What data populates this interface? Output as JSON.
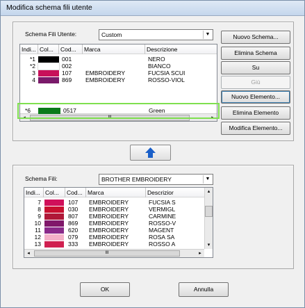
{
  "window": {
    "title": "Modifica schema fili utente"
  },
  "top": {
    "label": "Schema Fili Utente:",
    "combo_value": "Custom",
    "columns": [
      "Indi...",
      "Col...",
      "Cod...",
      "Marca",
      "Descrizione"
    ],
    "rows": [
      {
        "idx": "*1",
        "color": "#000000",
        "code": "001",
        "brand": "",
        "desc": "NERO"
      },
      {
        "idx": "*2",
        "color": "#ffffff",
        "code": "002",
        "brand": "",
        "desc": "BIANCO"
      },
      {
        "idx": "3",
        "color": "#c8105a",
        "code": "107",
        "brand": "EMBROIDERY",
        "desc": "FUCSIA SCUI"
      },
      {
        "idx": "4",
        "color": "#7a1a6a",
        "code": "869",
        "brand": "EMBROIDERY",
        "desc": "ROSSO-VIOL"
      }
    ],
    "added_row": {
      "idx": "*6",
      "color": "#0a7a1a",
      "code": "0517",
      "brand": "",
      "desc": "Green"
    },
    "scroll_thumb": "III"
  },
  "buttons": {
    "new_schema": "Nuovo Schema...",
    "delete_schema": "Elimina Schema",
    "up": "Su",
    "down": "Giù",
    "new_element": "Nuovo Elemento...",
    "delete_element": "Elimina Elemento",
    "edit_element": "Modifica Elemento...",
    "ok": "OK",
    "cancel": "Annulla"
  },
  "bottom": {
    "label": "Schema Fili:",
    "combo_value": "BROTHER EMBROIDERY",
    "columns": [
      "Indi...",
      "Col...",
      "Cod...",
      "Marca",
      "Descrizior"
    ],
    "rows": [
      {
        "idx": "7",
        "color": "#d0105a",
        "code": "107",
        "brand": "EMBROIDERY",
        "desc": "FUCSIA S"
      },
      {
        "idx": "8",
        "color": "#c81030",
        "code": "030",
        "brand": "EMBROIDERY",
        "desc": "VERMIGL"
      },
      {
        "idx": "9",
        "color": "#b01838",
        "code": "807",
        "brand": "EMBROIDERY",
        "desc": "CARMINE"
      },
      {
        "idx": "10",
        "color": "#80186a",
        "code": "869",
        "brand": "EMBROIDERY",
        "desc": "ROSSO-V"
      },
      {
        "idx": "11",
        "color": "#8a2a8a",
        "code": "620",
        "brand": "EMBROIDERY",
        "desc": "MAGENT"
      },
      {
        "idx": "12",
        "color": "#f4b0c8",
        "code": "079",
        "brand": "EMBROIDERY",
        "desc": "ROSA SA"
      },
      {
        "idx": "13",
        "color": "#d02050",
        "code": "333",
        "brand": "EMBROIDERY",
        "desc": "ROSSO A"
      }
    ],
    "scroll_thumb": "III"
  }
}
